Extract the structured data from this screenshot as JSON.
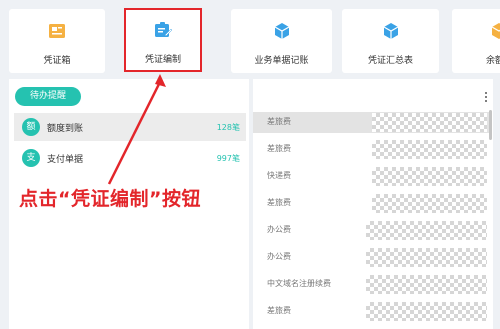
{
  "tiles": [
    {
      "label": "凭证箱",
      "icon": "voucher-box-icon",
      "color": "#f5b142"
    },
    {
      "label": "凭证编制",
      "icon": "voucher-edit-icon",
      "color": "#3aa2e6"
    },
    {
      "label": "业务单据记账",
      "icon": "cube-icon",
      "color": "#3aa2e6"
    },
    {
      "label": "凭证汇总表",
      "icon": "cube-icon",
      "color": "#3aa2e6"
    },
    {
      "label": "余额",
      "icon": "orange-cube-icon",
      "color": "#f5b142"
    }
  ],
  "reminders": {
    "button_label": "待办提醒",
    "items": [
      {
        "badge": "额",
        "label": "额度到账",
        "count": "128笔"
      },
      {
        "badge": "支",
        "label": "支付单据",
        "count": "997笔"
      }
    ]
  },
  "expenses": [
    "差旅费",
    "差旅费",
    "快递费",
    "差旅费",
    "办公费",
    "办公费",
    "中文域名注册续费",
    "差旅费"
  ],
  "annotation": "点击“凭证编制”按钮",
  "colors": {
    "accent": "#25c2b0",
    "annotation": "#e3262b",
    "tile_icon_blue": "#3aa2e6"
  }
}
